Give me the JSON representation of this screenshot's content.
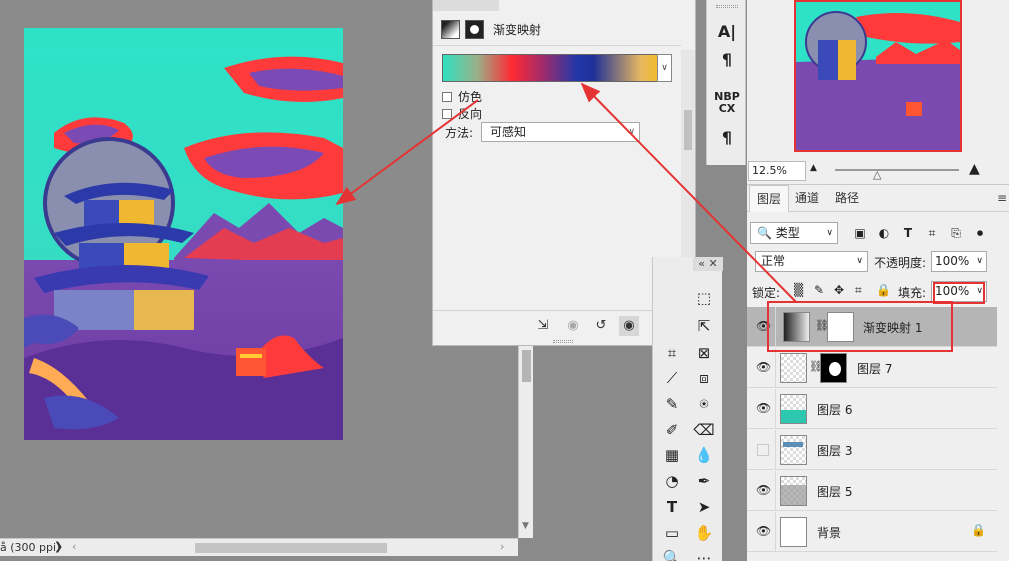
{
  "properties": {
    "title": "渐变映射",
    "dither_label": "仿色",
    "reverse_label": "反向",
    "method_label": "方法:",
    "method_value": "可感知"
  },
  "status": {
    "text": "å (300 ppi)",
    "menu_glyph": "❯"
  },
  "text_strip": {
    "char_icon": "A|",
    "para_icon": "¶",
    "nbp_line1": "NBP",
    "nbp_line2": "CX",
    "para2_icon": "¶"
  },
  "navigator": {
    "zoom": "12.5%"
  },
  "layers_panel": {
    "tabs": [
      "图层",
      "通道",
      "路径"
    ],
    "kind_filter": "类型",
    "blend_mode": "正常",
    "opacity_label": "不透明度:",
    "opacity_value": "100%",
    "lock_label": "锁定:",
    "fill_label": "填充:",
    "fill_value": "100%",
    "layers": [
      {
        "name": "渐变映射 1",
        "visible": true,
        "selected": true
      },
      {
        "name": "图层 7",
        "visible": true,
        "selected": false
      },
      {
        "name": "图层 6",
        "visible": true,
        "selected": false
      },
      {
        "name": "图层 3",
        "visible": false,
        "selected": false
      },
      {
        "name": "图层 5",
        "visible": true,
        "selected": false
      },
      {
        "name": "背景",
        "visible": true,
        "selected": false
      }
    ]
  },
  "colors": {
    "annotation": "#e53333",
    "gradient_stops": [
      "#30e0c0",
      "#ff2a33",
      "#2338a8",
      "#f0bb2a"
    ]
  },
  "icons": {
    "tools": [
      "marquee-icon",
      "move-icon",
      "crop-icon",
      "frame-icon",
      "eyedropper-icon",
      "healing-icon",
      "brush-icon",
      "stamp-icon",
      "history-brush-icon",
      "eraser-icon",
      "gradient-icon",
      "blur-icon",
      "dodge-icon",
      "pen-icon",
      "type-icon",
      "path-select-icon",
      "rectangle-icon",
      "hand-icon"
    ]
  }
}
